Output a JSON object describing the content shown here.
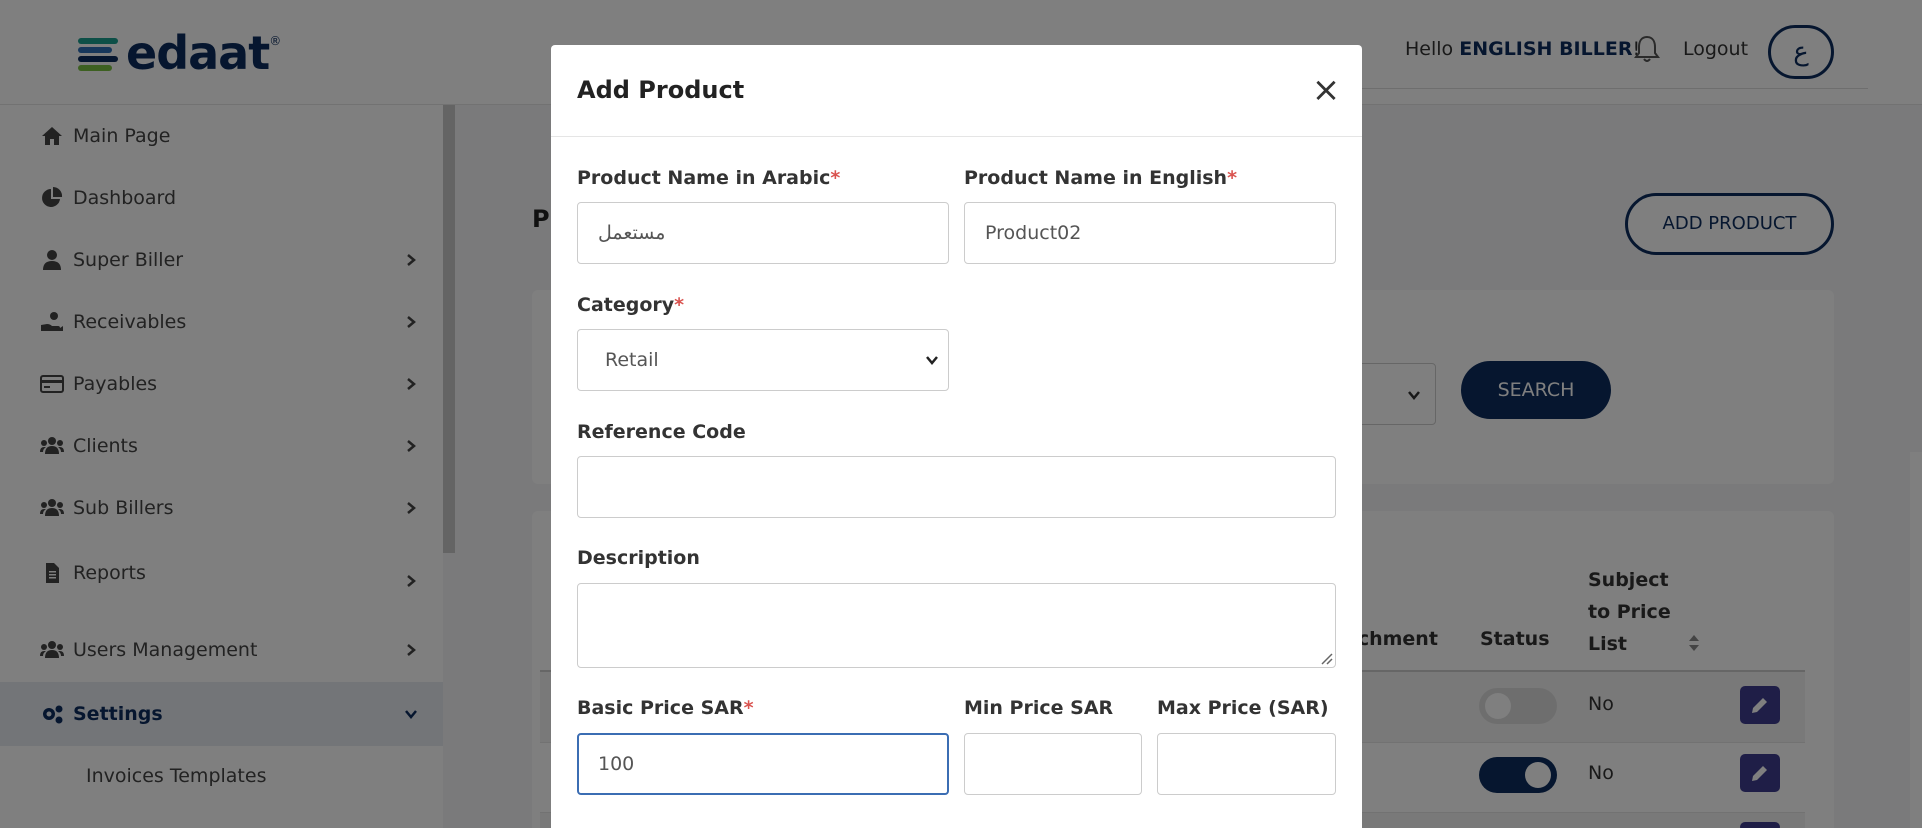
{
  "brand": {
    "name": "edaat",
    "trademark": "®",
    "bar_colors": [
      "#0c2d5e",
      "#1a9e8f",
      "#2e6fb7",
      "#7ac143"
    ]
  },
  "header": {
    "greeting": "Hello",
    "user_name": "ENGLISH BILLER",
    "greeting_suffix": "!",
    "logout_label": "Logout",
    "language_toggle": "ع"
  },
  "sidebar": {
    "items": [
      {
        "label": "Main Page",
        "icon": "home-icon",
        "has_chevron": false
      },
      {
        "label": "Dashboard",
        "icon": "pie-chart-icon",
        "has_chevron": false
      },
      {
        "label": "Super Biller",
        "icon": "user-icon",
        "has_chevron": true
      },
      {
        "label": "Receivables",
        "icon": "hand-coin-icon",
        "has_chevron": true
      },
      {
        "label": "Payables",
        "icon": "credit-card-icon",
        "has_chevron": true
      },
      {
        "label": "Clients",
        "icon": "users-icon",
        "has_chevron": true
      },
      {
        "label": "Sub Billers",
        "icon": "users-icon",
        "has_chevron": true
      },
      {
        "label": "Reports",
        "icon": "file-icon",
        "has_chevron": true
      },
      {
        "label": "Users Management",
        "icon": "users-icon",
        "has_chevron": true
      },
      {
        "label": "Settings",
        "icon": "gears-icon",
        "has_chevron": true,
        "active": true
      }
    ],
    "sub_items": [
      {
        "label": "Invoices Templates"
      }
    ]
  },
  "main": {
    "title_partial": "Pr",
    "add_product_label": "ADD PRODUCT",
    "search_label": "SEARCH",
    "table": {
      "headers": [
        "achment",
        "Status",
        "Subject to Price List"
      ],
      "subject_header_lines": [
        "Subject",
        "to Price",
        "List"
      ],
      "rows": [
        {
          "status": "off",
          "subject_to_price_list": "No"
        },
        {
          "status": "on",
          "subject_to_price_list": "No"
        }
      ]
    }
  },
  "modal": {
    "title": "Add Product",
    "close_symbol": "×",
    "required_marker": "*",
    "fields": {
      "name_ar": {
        "label": "Product Name in Arabic",
        "required": true,
        "value": "مستعمل"
      },
      "name_en": {
        "label": "Product Name in English",
        "required": true,
        "value": "Product02"
      },
      "category": {
        "label": "Category",
        "required": true,
        "value": "Retail"
      },
      "reference_code": {
        "label": "Reference Code",
        "required": false,
        "value": ""
      },
      "description": {
        "label": "Description",
        "required": false,
        "value": ""
      },
      "basic_price": {
        "label": "Basic Price SAR",
        "required": true,
        "value": "100"
      },
      "min_price": {
        "label": "Min Price SAR",
        "required": false,
        "value": ""
      },
      "max_price": {
        "label": "Max Price (SAR)",
        "required": false,
        "value": ""
      }
    }
  },
  "colors": {
    "brand_navy": "#0c2d5e",
    "edit_button": "#3e3d8f",
    "required": "#d9534f",
    "focus_border": "#3b6db3"
  }
}
